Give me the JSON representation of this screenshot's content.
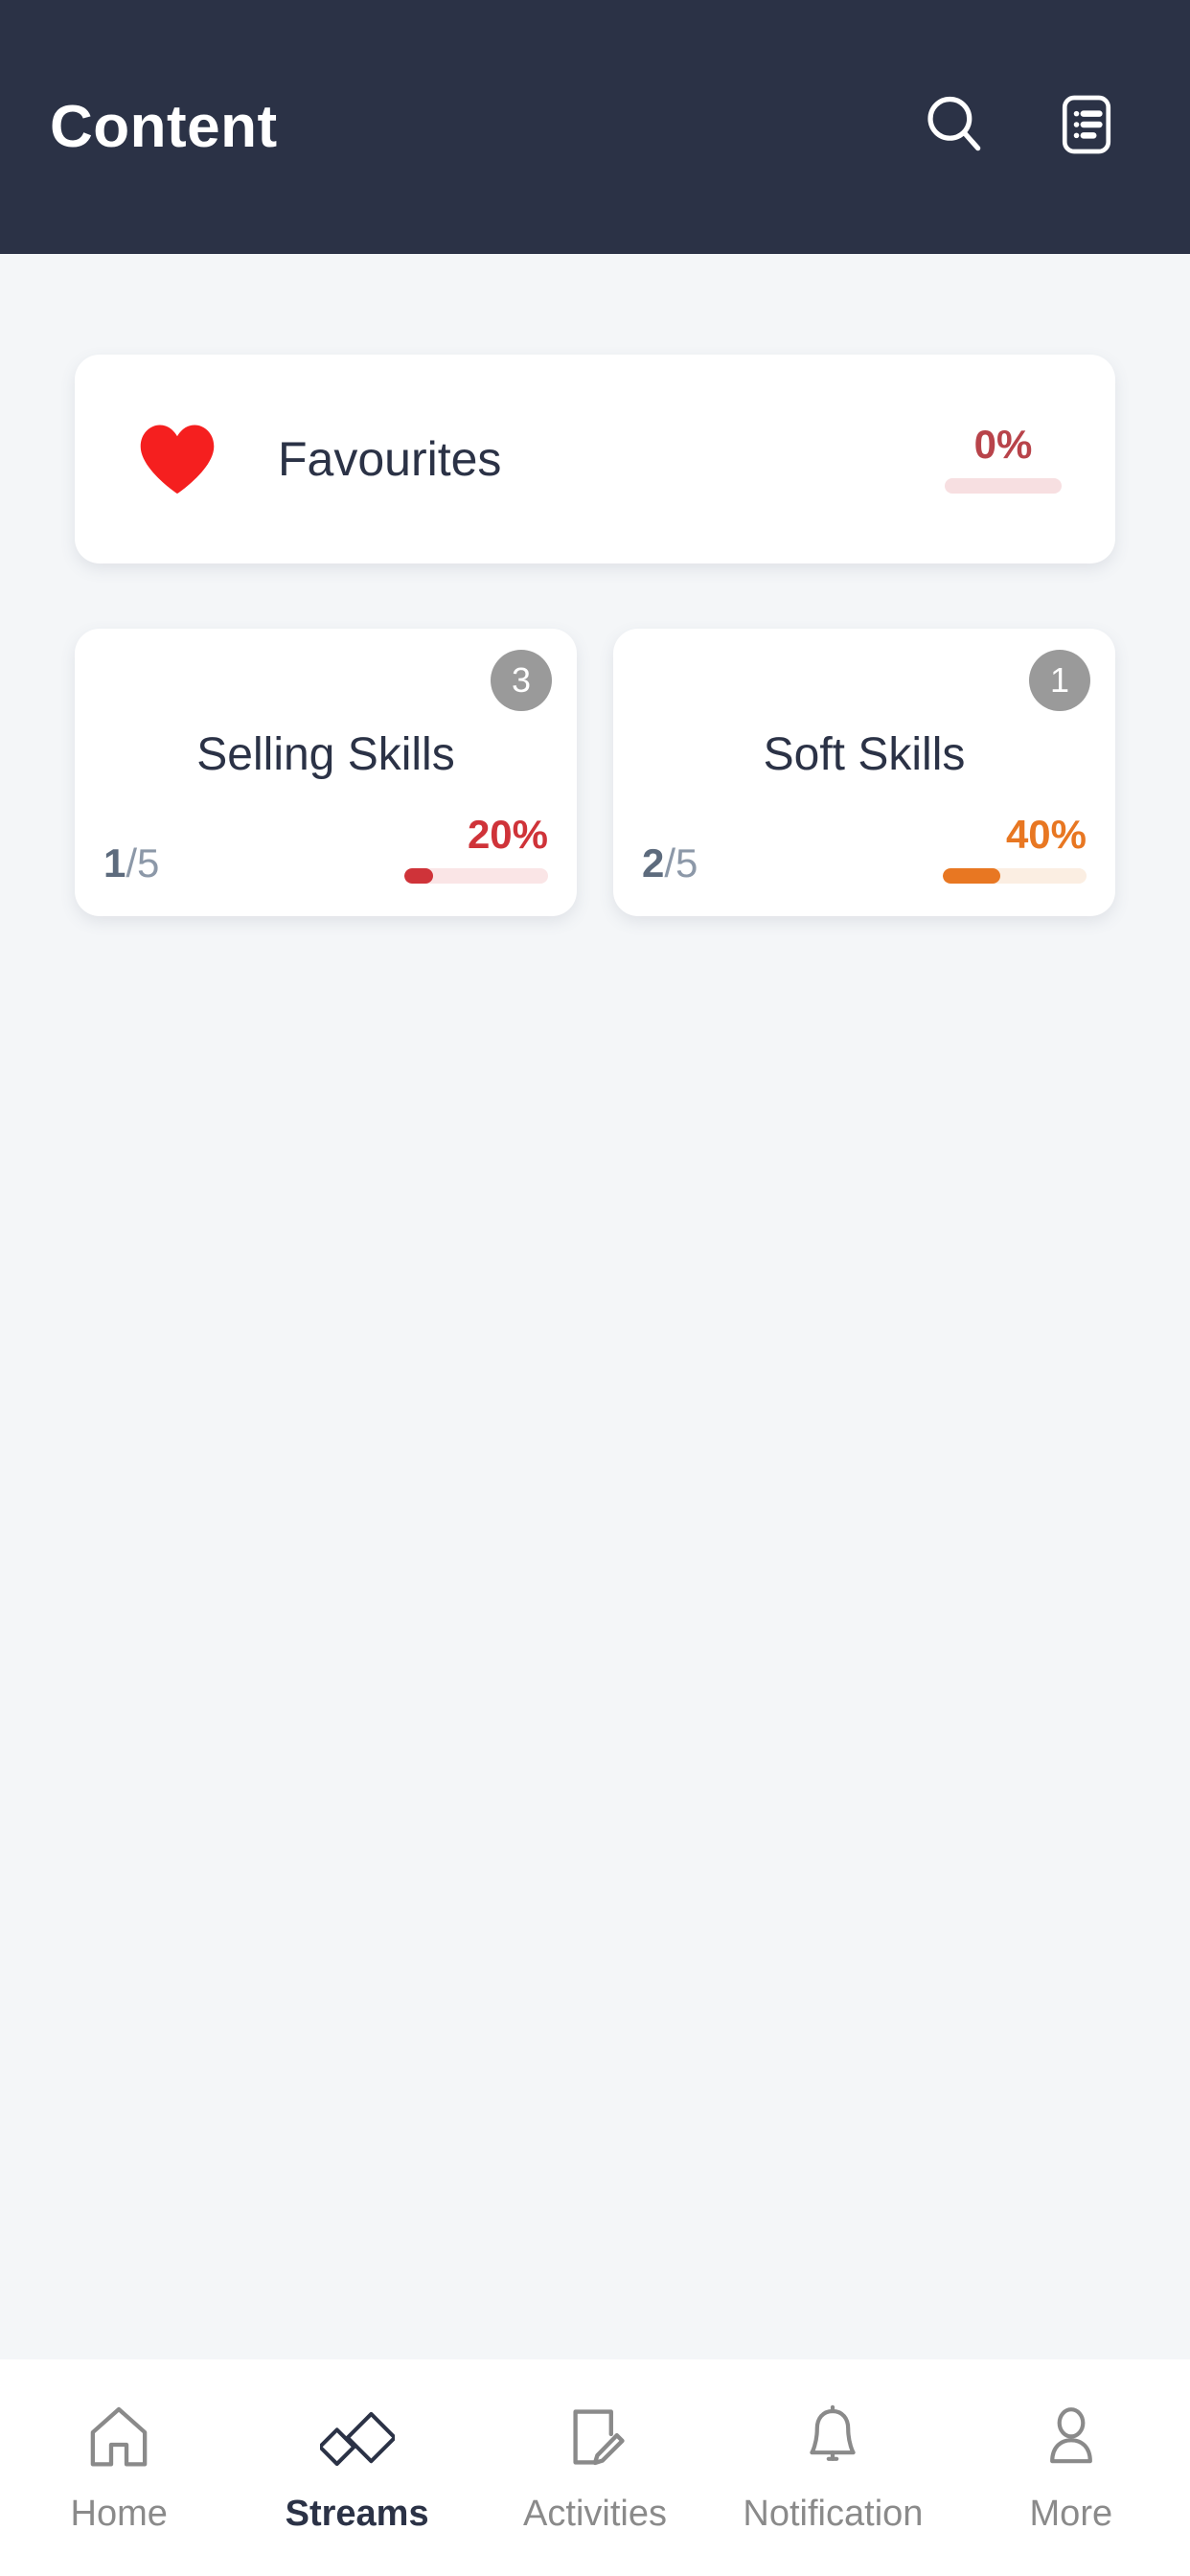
{
  "header": {
    "title": "Content",
    "search_icon": "search-icon",
    "list_icon": "list-view-icon"
  },
  "favourites": {
    "icon": "heart-icon",
    "label": "Favourites",
    "percent_label": "0%",
    "percent_value": 0,
    "accent_color": "#b8434a",
    "track_color": "#f7dfe1"
  },
  "streams": [
    {
      "badge": "3",
      "title": "Selling Skills",
      "completed": "1",
      "total": "/5",
      "percent_label": "20%",
      "percent_value": 20,
      "accent_color": "#cf3339",
      "track_color": "#fae5e6"
    },
    {
      "badge": "1",
      "title": "Soft Skills",
      "completed": "2",
      "total": "/5",
      "percent_label": "40%",
      "percent_value": 40,
      "accent_color": "#e87722",
      "track_color": "#fbeee2"
    }
  ],
  "bottom_nav": {
    "items": [
      {
        "label": "Home",
        "icon": "home-icon",
        "active": false
      },
      {
        "label": "Streams",
        "icon": "streams-icon",
        "active": true
      },
      {
        "label": "Activities",
        "icon": "document-edit-icon",
        "active": false
      },
      {
        "label": "Notification",
        "icon": "bell-icon",
        "active": false
      },
      {
        "label": "More",
        "icon": "person-icon",
        "active": false
      }
    ]
  },
  "colors": {
    "header_bg": "#2b3246",
    "page_bg": "#f4f6f8",
    "card_bg": "#ffffff",
    "heart_red": "#f51f1f",
    "badge_gray": "#9a9a9a",
    "nav_inactive": "#8a8a8a",
    "nav_active": "#2b3246"
  }
}
